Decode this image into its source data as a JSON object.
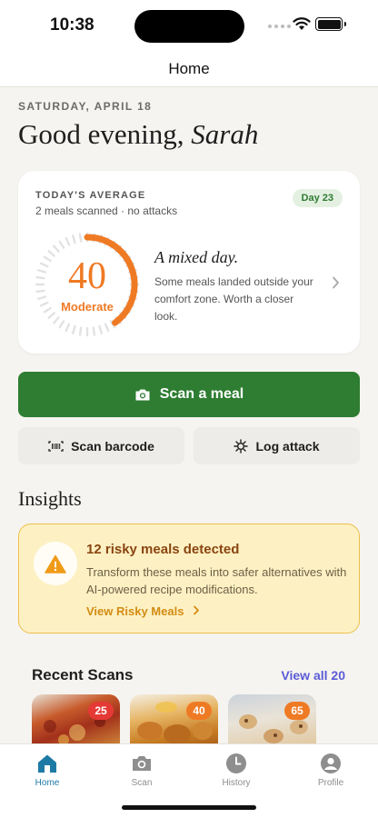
{
  "status_bar": {
    "time": "10:38"
  },
  "nav": {
    "title": "Home"
  },
  "header": {
    "date": "SATURDAY, APRIL 18",
    "greeting": "Good evening,",
    "name": "Sarah"
  },
  "today_card": {
    "title": "TODAY'S AVERAGE",
    "subtitle": "2 meals scanned · no attacks",
    "day_badge": "Day 23",
    "score": "40",
    "score_fraction": 0.4,
    "score_label": "Moderate",
    "verdict": "A mixed day.",
    "verdict_body": "Some meals landed outside your comfort zone. Worth a closer look.",
    "accent_color": "#ef7a24"
  },
  "actions": {
    "scan_meal": "Scan a meal",
    "scan_barcode": "Scan barcode",
    "log_attack": "Log attack"
  },
  "insights": {
    "heading": "Insights",
    "risk_title": "12 risky meals detected",
    "risk_body": "Transform these meals into safer alternatives with AI-powered recipe modifications.",
    "risk_link": "View Risky Meals"
  },
  "recent": {
    "heading": "Recent Scans",
    "view_all": "View all 20",
    "items": [
      {
        "score": "25",
        "badge_color": "#e53935"
      },
      {
        "score": "40",
        "badge_color": "#ef7a24"
      },
      {
        "score": "65",
        "badge_color": "#ef7a24"
      }
    ]
  },
  "tabs": [
    {
      "label": "Home",
      "icon": "home-icon",
      "active": true
    },
    {
      "label": "Scan",
      "icon": "camera-icon",
      "active": false
    },
    {
      "label": "History",
      "icon": "clock-icon",
      "active": false
    },
    {
      "label": "Profile",
      "icon": "person-icon",
      "active": false
    }
  ],
  "colors": {
    "primary_green": "#2e7d32",
    "warning_bg": "#fdf1c4",
    "link_purple": "#5b5bd6",
    "tab_active": "#1d7aa5"
  }
}
